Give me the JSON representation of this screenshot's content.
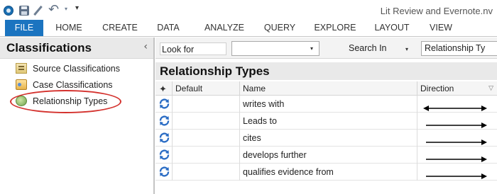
{
  "window": {
    "title": "Lit Review and Evernote.nv"
  },
  "qat": {
    "app_icon": "app-logo-icon",
    "save_icon": "save-icon",
    "edit_icon": "pen-icon",
    "undo_icon": "undo-icon",
    "undo_glyph": "↶",
    "dropdown_glyph": "▾",
    "customize_glyph": "▾"
  },
  "ribbon": {
    "tabs": [
      "FILE",
      "HOME",
      "CREATE",
      "DATA",
      "ANALYZE",
      "QUERY",
      "EXPLORE",
      "LAYOUT",
      "VIEW"
    ],
    "accent": "#1b74c0"
  },
  "navigation": {
    "title": "Classifications",
    "collapse_glyph": "‹",
    "items": [
      {
        "label": "Source Classifications",
        "icon": "source-classification-icon"
      },
      {
        "label": "Case Classifications",
        "icon": "case-classification-icon"
      },
      {
        "label": "Relationship Types",
        "icon": "relationship-type-icon",
        "selected": true
      }
    ],
    "highlight_color": "#d4322e"
  },
  "find_bar": {
    "look_for_label": "Look for",
    "look_for_value": "",
    "search_in_label": "Search In",
    "search_in_value": "Relationship Ty",
    "dropdown_glyph": "▾"
  },
  "list": {
    "title": "Relationship Types",
    "columns": {
      "pin": "✦",
      "default": "Default",
      "name": "Name",
      "direction": "Direction",
      "sort_glyph": "▽"
    },
    "rows": [
      {
        "default": "",
        "name": "writes with",
        "direction": "both"
      },
      {
        "default": "",
        "name": "Leads to",
        "direction": "right"
      },
      {
        "default": "",
        "name": "cites",
        "direction": "right"
      },
      {
        "default": "",
        "name": "develops further",
        "direction": "right"
      },
      {
        "default": "",
        "name": "qualifies evidence from",
        "direction": "right"
      }
    ],
    "row_icon": "relationship-refresh-icon",
    "icon_color": "#2a6cc4"
  }
}
